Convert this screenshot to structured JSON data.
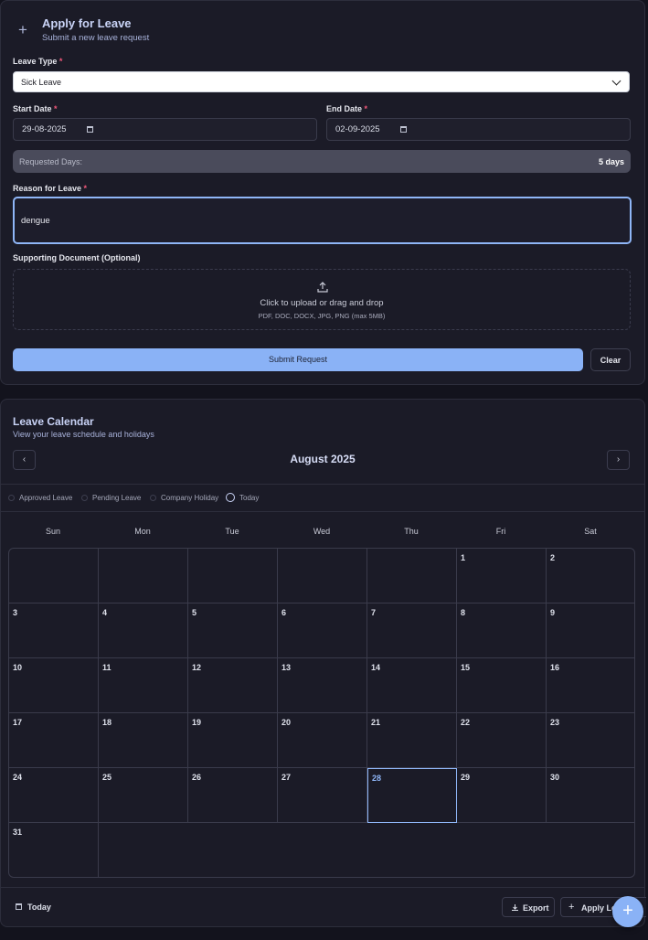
{
  "apply": {
    "title": "Apply for Leave",
    "subtitle": "Submit a new leave request",
    "leave_type_label": "Leave Type",
    "leave_type_value": "Sick Leave",
    "start_date_label": "Start Date",
    "start_date_value": "29-08-2025",
    "end_date_label": "End Date",
    "end_date_value": "02-09-2025",
    "requested_days_label": "Requested Days:",
    "requested_days_value": "5 days",
    "reason_label": "Reason for Leave",
    "reason_value": "dengue",
    "doc_label": "Supporting Document (Optional)",
    "upload_text": "Click to upload or drag and drop",
    "upload_hint": "PDF, DOC, DOCX, JPG, PNG (max 5MB)",
    "submit_label": "Submit Request",
    "clear_label": "Clear",
    "required_mark": "*"
  },
  "calendar": {
    "title": "Leave Calendar",
    "subtitle": "View your leave schedule and holidays",
    "month_label": "August 2025",
    "prev_glyph": "‹",
    "next_glyph": "›",
    "legend": [
      "Approved Leave",
      "Pending Leave",
      "Company Holiday",
      "Today"
    ],
    "weekdays": [
      "Sun",
      "Mon",
      "Tue",
      "Wed",
      "Thu",
      "Fri",
      "Sat"
    ],
    "first_weekday_index": 5,
    "days_in_month": 31,
    "today": 28,
    "footer_today_label": "Today",
    "export_label": "Export",
    "apply_leave_label": "Apply Leave"
  },
  "fab": {
    "glyph": "+"
  },
  "colors": {
    "accent": "#8ab2f6",
    "required": "#f2587a",
    "background": "#13131d",
    "card": "#1b1b27"
  }
}
